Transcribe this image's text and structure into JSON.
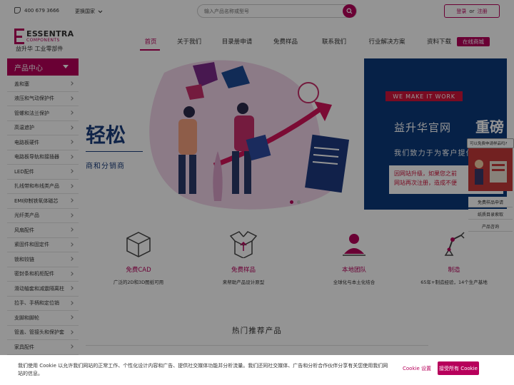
{
  "topbar": {
    "phone": "400 679 3666",
    "country": "更换国家",
    "search_placeholder": "输入产品名称或型号",
    "login": "登录",
    "or": "or",
    "register": "注册"
  },
  "logo": {
    "brand": "ESSENTRA",
    "sub": "COMPONENTS",
    "cn": "益升华 工业零部件"
  },
  "nav": {
    "items": [
      "首页",
      "关于我们",
      "目录册申请",
      "免费样品",
      "联系我们",
      "行业解决方案",
      "资料下载"
    ],
    "shop": "在线商城"
  },
  "sidebar": {
    "title": "产品中心",
    "items": [
      "盖和塞",
      "液压和气动保护件",
      "管螺和法兰保护",
      "高温遮护",
      "电路板硬件",
      "电路板导轨和接插器",
      "LED配件",
      "扎线带和布线类产品",
      "EMI抑制铁氧体磁芯",
      "光纤类产品",
      "风扇配件",
      "紧固件和固定件",
      "锁和铰链",
      "密封条和机柜配件",
      "滑动轴套和减震隔离柱",
      "拉手、手柄和定位销",
      "支脚和脚轮",
      "管盖、管接头和保护套",
      "家具配件"
    ]
  },
  "banner": {
    "left_title": "轻松",
    "left_sub": "商和分销商",
    "badge": "WE MAKE IT WORK",
    "title1": "益升华官网",
    "title1_bold": "重磅",
    "title2": "我们致力于为客户提供",
    "note1": "因网站升级，如果您之前",
    "note2": "网站再次注册，造成不便"
  },
  "float": {
    "tip": "可以免费申请样品吗?",
    "links": [
      "免费样品申请",
      "纸质目录索取",
      "产品咨询"
    ]
  },
  "features": [
    {
      "title": "免费CAD",
      "desc": "广泛的2D和3D图纸可用"
    },
    {
      "title": "免费样品",
      "desc": "来帮助产品设计原型"
    },
    {
      "title": "本地团队",
      "desc": "全球化与本土化结合"
    },
    {
      "title": "制造",
      "desc": "65年+制造经验，14个生产基地"
    }
  ],
  "hot_products_title": "热门推荐产品",
  "cookie": {
    "text": "我们使用 Cookie 以允许我们网站的正常工作、个性化设计内容和广告、提供社交媒体功能并分析流量。我们还同社交媒体、广告和分析合作伙伴分享有关您使用我们网站的信息。",
    "settings": "Cookie 设置",
    "accept": "接受所有 Cookie"
  },
  "colors": {
    "brand": "#b7005b",
    "banner_blue": "#0c3a7a",
    "badge_red": "#d0143c"
  }
}
